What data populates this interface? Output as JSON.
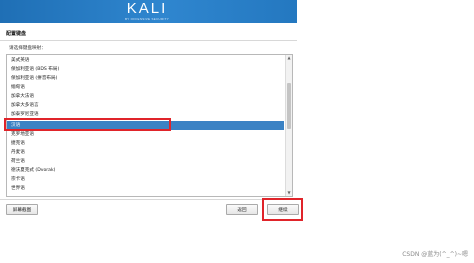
{
  "header": {
    "logo_text": "KALI",
    "logo_tagline": "BY OFFENSIVE SECURITY"
  },
  "page": {
    "title": "配置键盘",
    "prompt": "请选择键盘映射："
  },
  "keymap_list": {
    "items": [
      {
        "label": "美式英语",
        "selected": false
      },
      {
        "label": "保加利亚语 (BDS 布局)",
        "selected": false
      },
      {
        "label": "保加利亚语 (拼音布局)",
        "selected": false
      },
      {
        "label": "缅甸语",
        "selected": false
      },
      {
        "label": "加拿大法语",
        "selected": false
      },
      {
        "label": "加拿大多语言",
        "selected": false
      },
      {
        "label": "加泰罗尼亚语",
        "selected": false
      },
      {
        "label": "汉语",
        "selected": true
      },
      {
        "label": "克罗地亚语",
        "selected": false
      },
      {
        "label": "捷克语",
        "selected": false
      },
      {
        "label": "丹麦语",
        "selected": false
      },
      {
        "label": "荷兰语",
        "selected": false
      },
      {
        "label": "德沃夏克式 (Dvorak)",
        "selected": false
      },
      {
        "label": "宗卡语",
        "selected": false
      },
      {
        "label": "世界语",
        "selected": false
      }
    ]
  },
  "buttons": {
    "screenshot": "屏幕截图",
    "back": "返回",
    "continue": "继续"
  },
  "watermark": "CSDN @蓝为(^_^)~嗯",
  "colors": {
    "banner": "#2478c0",
    "selection": "#3b82c4",
    "highlight": "#e0242a"
  }
}
